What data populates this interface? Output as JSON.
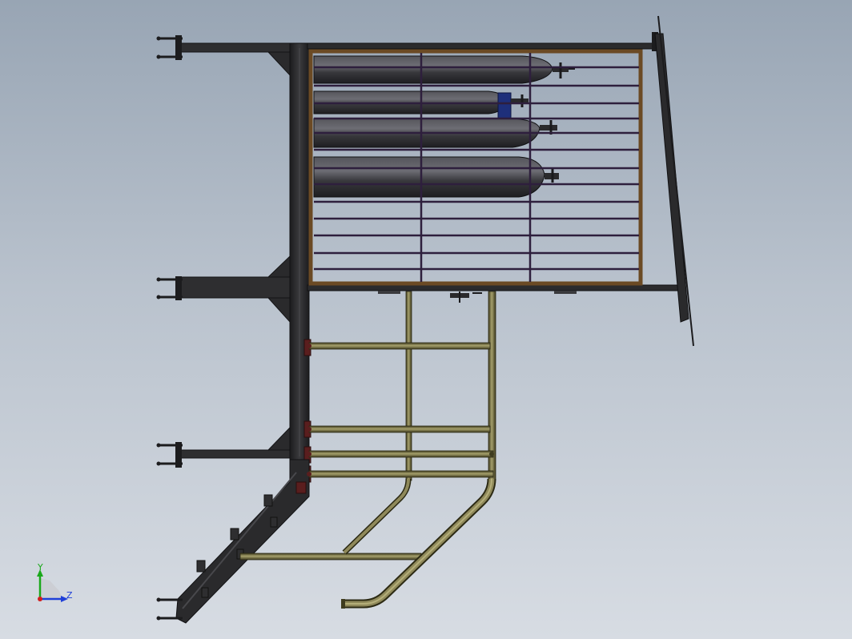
{
  "viewport": {
    "background_top": "#98a5b4",
    "background_bottom": "#d7dce3"
  },
  "triad": {
    "y_label": "Y",
    "z_label": "Z",
    "y_color": "#1aa81a",
    "z_color": "#1f3fd8",
    "x_color": "#d21e1e"
  },
  "colors": {
    "steel_frame": "#2b2b2d",
    "steel_dark": "#1a1a1c",
    "wood_border": "#6b4a24",
    "rail_purple": "#2e1f3d",
    "cylinder_body": "#3a3a3e",
    "cylinder_highlight": "#6a6a70",
    "valve_blue": "#1e2f7a",
    "pipe_olive": "#5f5a32",
    "pipe_highlight": "#a39d6a",
    "bolt_red": "#5a1e1e"
  },
  "model": {
    "cylinder_count": 4,
    "rack_horizontal_rails": 12,
    "rack_vertical_posts": 3,
    "wall_brackets": 5
  }
}
